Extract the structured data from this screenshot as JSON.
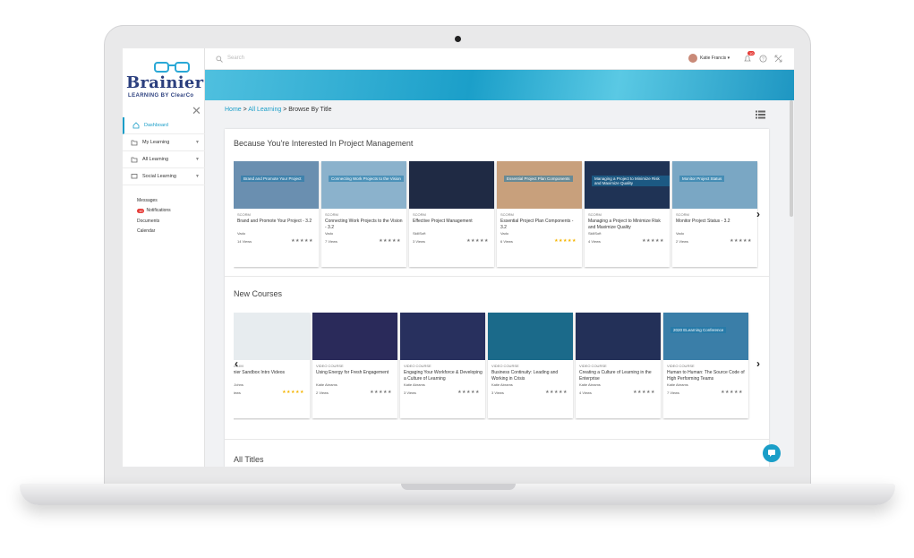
{
  "brand": {
    "name": "Brainier",
    "sub": "LEARNING BY ClearCo"
  },
  "search": {
    "placeholder": "Search"
  },
  "user": {
    "name": "Katie Francis ▾",
    "notifications": "10"
  },
  "sidebar": {
    "items": [
      {
        "label": "Dashboard",
        "icon": "home-icon"
      },
      {
        "label": "My Learning",
        "icon": "folder-icon"
      },
      {
        "label": "All Learning",
        "icon": "folder-icon"
      },
      {
        "label": "Social Learning",
        "icon": "chat-icon"
      }
    ],
    "sub": [
      {
        "label": "Messages"
      },
      {
        "label": "Notifications",
        "badge": "10"
      },
      {
        "label": "Documents"
      },
      {
        "label": "Calendar"
      }
    ]
  },
  "breadcrumb": {
    "home": "Home",
    "sep1": " > ",
    "all": "All Learning",
    "sep2": " > ",
    "current": "Browse By Title"
  },
  "sections": {
    "interested": "Because You're Interested In Project Management",
    "new": "New Courses",
    "all": "All Titles"
  },
  "interested": [
    {
      "type": "SCORM",
      "title": "Brand and Promote Your Project - 3.2",
      "author": "Vado",
      "views": "14 Views",
      "cap": "Brand and Promote Your Project",
      "color": "#6a8fb0",
      "rated": false
    },
    {
      "type": "SCORM",
      "title": "Connecting Work Projects to the Vision - 3.2",
      "author": "Vado",
      "views": "7 Views",
      "cap": "Connecting Work Projects to the Vision",
      "color": "#8bb2cc",
      "rated": false
    },
    {
      "type": "SCORM",
      "title": "Effective Project Management",
      "author": "SkillSoft",
      "views": "3 Views",
      "cap": "",
      "color": "#1f2a44",
      "rated": false
    },
    {
      "type": "SCORM",
      "title": "Essential Project Plan Components - 3.2",
      "author": "Vado",
      "views": "6 Views",
      "cap": "Essential Project Plan Components",
      "color": "#c8a07c",
      "rated": true
    },
    {
      "type": "SCORM",
      "title": "Managing a Project to Minimize Risk and Maximize Quality",
      "author": "SkillSoft",
      "views": "4 Views",
      "cap": "Managing a Project to Minimize Risk and Maximize Quality",
      "color": "#1f3355",
      "rated": false
    },
    {
      "type": "SCORM",
      "title": "Monitor Project Status - 3.2",
      "author": "Vado",
      "views": "2 Views",
      "cap": "Monitor Project Status",
      "color": "#7aa7c4",
      "rated": false
    }
  ],
  "newcourses": [
    {
      "type": "IMUSLIM",
      "title": "rainier Sandbox Intro Videos",
      "author": "ely Johns",
      "views": "1 Views",
      "cap": "",
      "color": "#e7ecef",
      "rated": true
    },
    {
      "type": "VIDEO COURSE",
      "title": "Using Energy for Fresh Engagement",
      "author": "Katie Abrams",
      "views": "2 Views",
      "cap": "",
      "color": "#2a2a5a",
      "rated": false
    },
    {
      "type": "VIDEO COURSE",
      "title": "Engaging Your Workforce & Developing a Culture of Learning",
      "author": "Katie Abrams",
      "views": "3 Views",
      "cap": "",
      "color": "#28305e",
      "rated": false
    },
    {
      "type": "VIDEO COURSE",
      "title": "Business Continuity: Leading and Working in Crisis",
      "author": "Katie Abrams",
      "views": "3 Views",
      "cap": "",
      "color": "#1b6a8a",
      "rated": false
    },
    {
      "type": "VIDEO COURSE",
      "title": "Creating a Culture of Learning in the Enterprise",
      "author": "Katie Abrams",
      "views": "4 Views",
      "cap": "",
      "color": "#233058",
      "rated": false
    },
    {
      "type": "VIDEO COURSE",
      "title": "Human to Human: The Source Code of High Performing Teams",
      "author": "Katie Abrams",
      "views": "7 Views",
      "cap": "2020 ELearning Conference",
      "color": "#3a7ea8",
      "rated": false
    }
  ],
  "stars": "★★★★★"
}
